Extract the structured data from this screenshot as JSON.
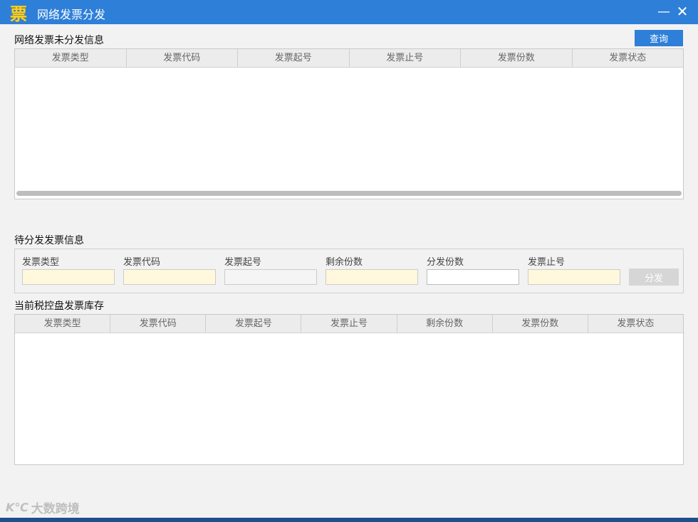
{
  "window": {
    "title": "网络发票分发",
    "app_icon_glyph": "票",
    "minimize_glyph": "—",
    "close_glyph": "✕"
  },
  "undistributed": {
    "label": "网络发票未分发信息",
    "query_button": "查询",
    "columns": [
      "发票类型",
      "发票代码",
      "发票起号",
      "发票止号",
      "发票份数",
      "发票状态"
    ],
    "rows": []
  },
  "pending": {
    "label": "待分发发票信息",
    "fields": [
      {
        "label": "发票类型",
        "value": ""
      },
      {
        "label": "发票代码",
        "value": ""
      },
      {
        "label": "发票起号",
        "value": ""
      },
      {
        "label": "剩余份数",
        "value": ""
      },
      {
        "label": "分发份数",
        "value": ""
      },
      {
        "label": "发票止号",
        "value": ""
      }
    ],
    "distribute_button": "分发"
  },
  "inventory": {
    "label": "当前税控盘发票库存",
    "columns": [
      "发票类型",
      "发票代码",
      "发票起号",
      "发票止号",
      "剩余份数",
      "发票份数",
      "发票状态"
    ],
    "rows": []
  },
  "watermark": {
    "logo": "K℃",
    "text": "大数跨境"
  },
  "colors": {
    "titlebar": "#2e7fd8",
    "accent": "#2e7fd8",
    "highlight_input": "#fff8dc"
  }
}
